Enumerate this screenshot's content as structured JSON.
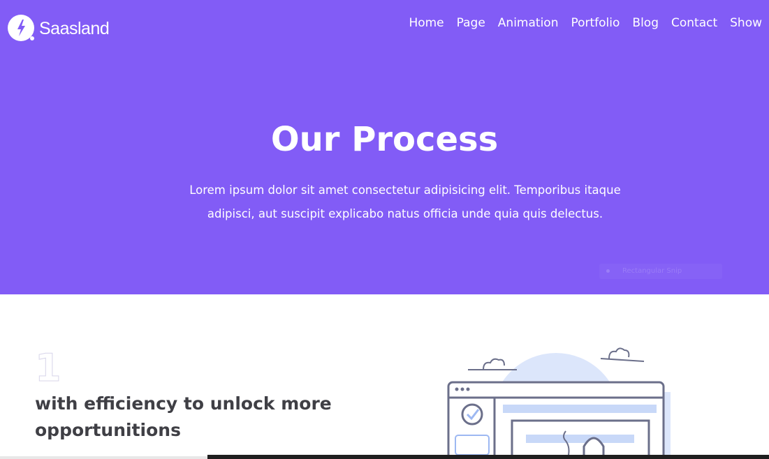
{
  "brand": {
    "name": "Saasland",
    "logo_icon": "lightning-bolt-icon"
  },
  "nav": {
    "items": [
      {
        "label": "Home"
      },
      {
        "label": "Page"
      },
      {
        "label": "Animation"
      },
      {
        "label": "Portfolio"
      },
      {
        "label": "Blog"
      },
      {
        "label": "Contact"
      },
      {
        "label": "Show"
      }
    ]
  },
  "hero": {
    "title": "Our Process",
    "description_line1": "Lorem ipsum dolor sit amet consectetur adipisicing elit. Temporibus itaque",
    "description_line2": "adipisci, aut suscipit explicabo natus officia unde quia quis delectus.",
    "ghost_tooltip": "Rectangular Snip"
  },
  "process": {
    "step_number": "1",
    "heading": "with efficiency to unlock more opportunitions",
    "illustration_icon": "browser-window-illustration"
  },
  "colors": {
    "hero_background": "#825cf6",
    "heading_text": "#3f3f45",
    "illustration_stroke": "#6b6f8a",
    "illustration_fill": "#dce6fb"
  }
}
